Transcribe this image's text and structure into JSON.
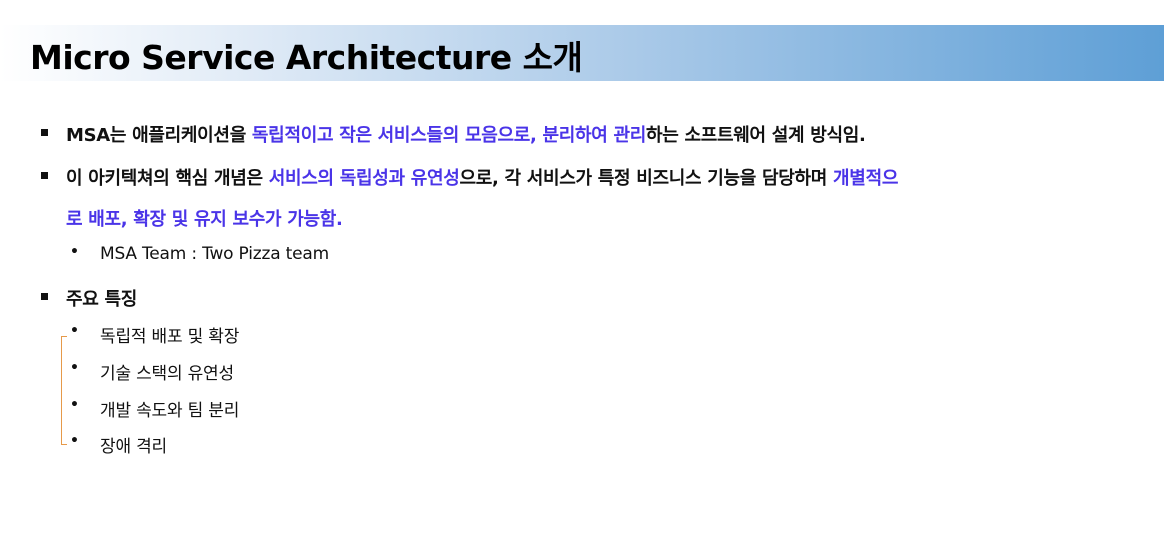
{
  "slide": {
    "title": "Micro Service Architecture 소개"
  },
  "bullets": [
    {
      "segments": [
        {
          "text": "MSA는 애플리케이션을 ",
          "hl": false
        },
        {
          "text": "독립적이고 작은 서비스들의 모음으로, 분리하여 관리",
          "hl": true
        },
        {
          "text": "하는 소프트웨어 설계 방식임.",
          "hl": false
        }
      ]
    },
    {
      "segments": [
        {
          "text": "이 아키텍쳐의 핵심 개념은 ",
          "hl": false
        },
        {
          "text": "서비스의 독립성과 유연성",
          "hl": true
        },
        {
          "text": "으로, 각 서비스가 특정 비즈니스 기능을 담당하며 ",
          "hl": false
        },
        {
          "text": "개별적으",
          "hl": true
        }
      ],
      "continuation": "로 배포, 확장 및 유지 보수가 가능함.",
      "sub": "MSA Team : Two Pizza team"
    },
    {
      "label": "주요 특징",
      "items": [
        "독립적 배포 및 확장",
        "기술 스택의 유연성",
        "개발 속도와 팀 분리",
        "장애 격리"
      ]
    }
  ],
  "colors": {
    "highlight": "#4a34e8",
    "bracket": "#e69a4a",
    "title_gradient_end": "#5e9fd6"
  }
}
